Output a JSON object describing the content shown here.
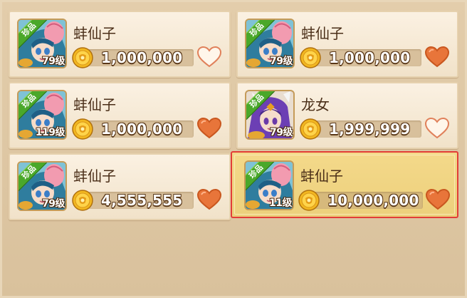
{
  "colors": {
    "heart_filled": "#e8753a",
    "heart_outline": "#e0805a",
    "rare_badge": "#4aa82a",
    "selection_border": "#e23d37"
  },
  "cards": [
    {
      "name": "蚌仙子",
      "level": "79级",
      "badge": "珍品",
      "price": "1,000,000",
      "favorited": false,
      "hero": "pearl-fairy"
    },
    {
      "name": "蚌仙子",
      "level": "79级",
      "badge": "珍品",
      "price": "1,000,000",
      "favorited": true,
      "hero": "pearl-fairy"
    },
    {
      "name": "蚌仙子",
      "level": "119级",
      "badge": "珍品",
      "price": "1,000,000",
      "favorited": true,
      "hero": "pearl-fairy"
    },
    {
      "name": "龙女",
      "level": "79级",
      "badge": "珍品",
      "price": "1,999,999",
      "favorited": false,
      "hero": "dragon-girl"
    },
    {
      "name": "蚌仙子",
      "level": "79级",
      "badge": "珍品",
      "price": "4,555,555",
      "favorited": true,
      "hero": "pearl-fairy"
    },
    {
      "name": "蚌仙子",
      "level": "11级",
      "badge": "珍品",
      "price": "10,000,000",
      "favorited": true,
      "hero": "pearl-fairy",
      "selected": true
    }
  ]
}
